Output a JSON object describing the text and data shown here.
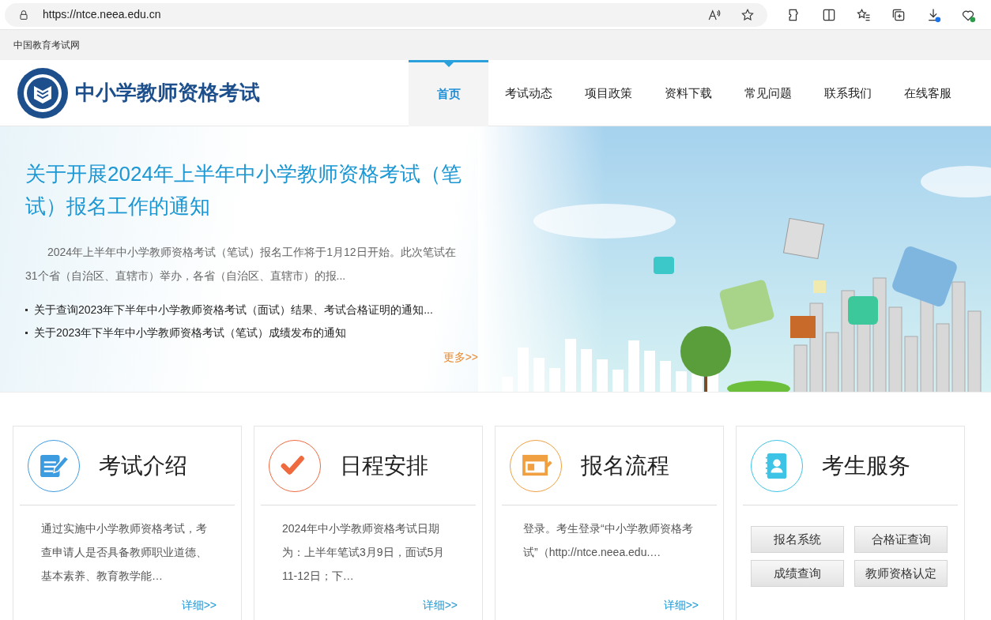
{
  "browser": {
    "url": "https://ntce.neea.edu.cn"
  },
  "top_bar": {
    "site_name": "中国教育考试网"
  },
  "header": {
    "logo_text": "中小学教师资格考试",
    "nav": [
      {
        "label": "首页",
        "selected": true
      },
      {
        "label": "考试动态",
        "selected": false
      },
      {
        "label": "项目政策",
        "selected": false
      },
      {
        "label": "资料下载",
        "selected": false
      },
      {
        "label": "常见问题",
        "selected": false
      },
      {
        "label": "联系我们",
        "selected": false
      },
      {
        "label": "在线客服",
        "selected": false
      }
    ]
  },
  "hero": {
    "headline": "关于开展2024年上半年中小学教师资格考试（笔试）报名工作的通知",
    "summary": "2024年上半年中小学教师资格考试（笔试）报名工作将于1月12日开始。此次笔试在31个省（自治区、直辖市）举办，各省（自治区、直辖市）的报...",
    "news": [
      "关于查询2023年下半年中小学教师资格考试（面试）结果、考试合格证明的通知...",
      "关于2023年下半年中小学教师资格考试（笔试）成绩发布的通知"
    ],
    "more": "更多>>"
  },
  "cards": [
    {
      "kind": "text",
      "color": "#3d9be0",
      "title": "考试介绍",
      "text": "通过实施中小学教师资格考试，考查申请人是否具备教师职业道德、基本素养、教育教学能…",
      "link": "详细>>"
    },
    {
      "kind": "text",
      "color": "#ef6a3f",
      "title": "日程安排",
      "text": "2024年中小学教师资格考试日期为：上半年笔试3月9日，面试5月11-12日；下…",
      "link": "详细>>"
    },
    {
      "kind": "text",
      "color": "#f0a040",
      "title": "报名流程",
      "text": "登录。考生登录“中小学教师资格考试”（http://ntce.neea.edu.…",
      "link": "详细>>"
    },
    {
      "kind": "buttons",
      "color": "#3cc3e6",
      "title": "考生服务",
      "buttons": [
        "报名系统",
        "合格证查询",
        "成绩查询",
        "教师资格认定"
      ]
    }
  ]
}
